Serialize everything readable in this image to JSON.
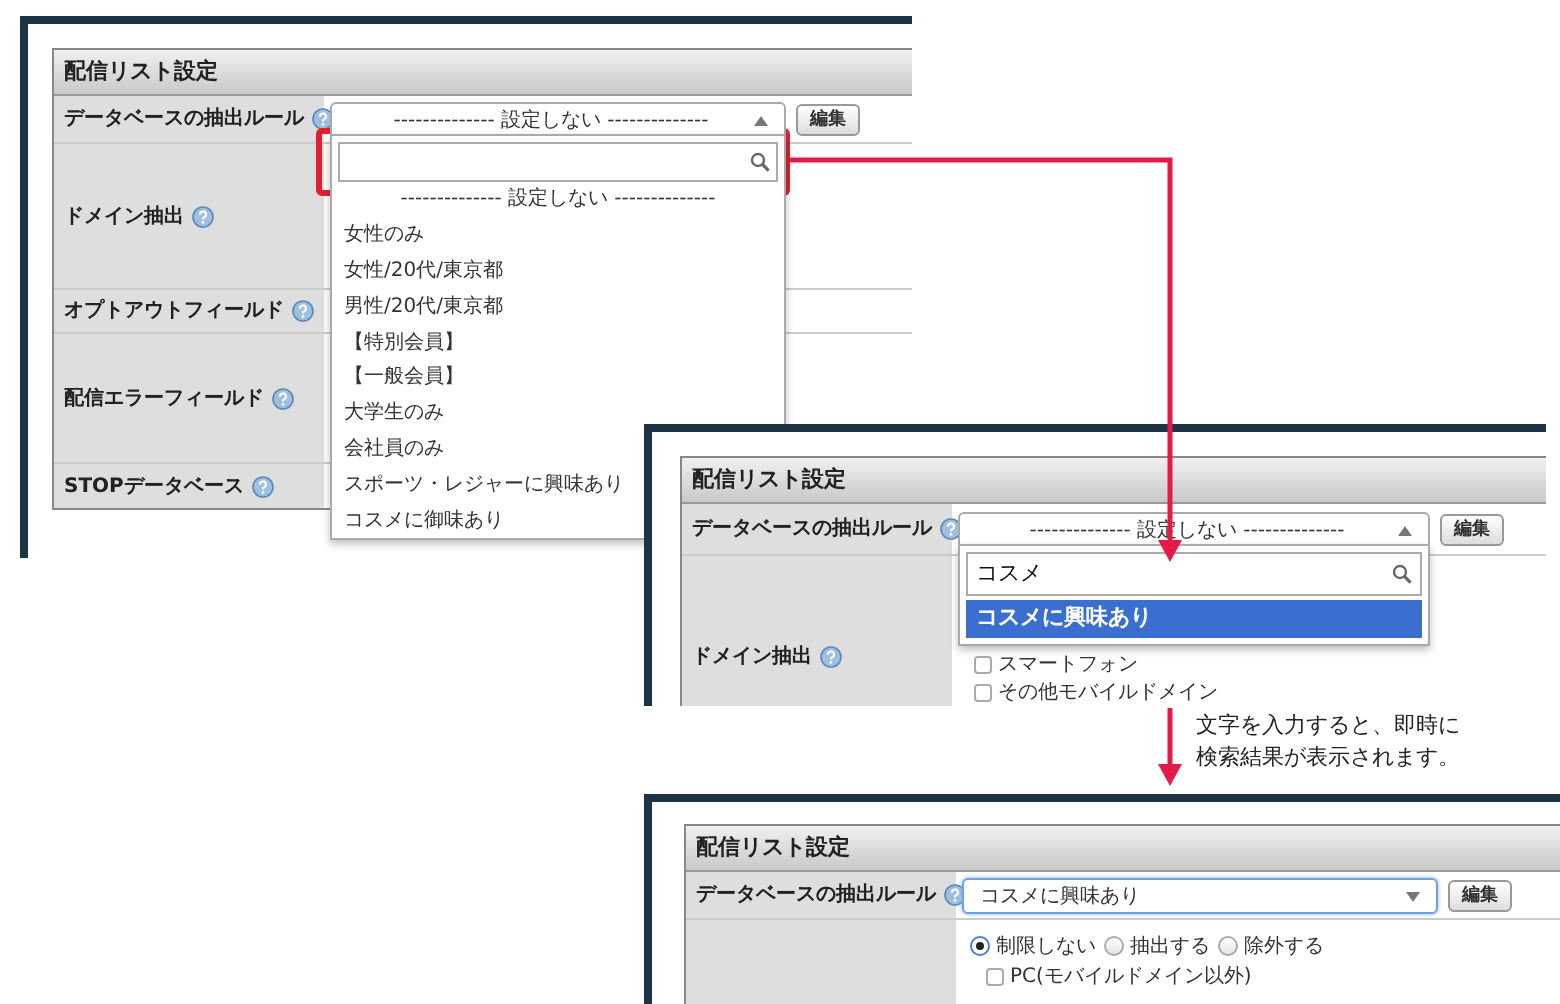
{
  "step1": {
    "title": "配信リスト設定",
    "rows": [
      {
        "label": "データベースの抽出ルール"
      },
      {
        "label": "ドメイン抽出"
      },
      {
        "label": "オプトアウトフィールド"
      },
      {
        "label": "配信エラーフィールド"
      },
      {
        "label": "STOPデータベース"
      }
    ],
    "select": {
      "value": "-------------- 設定しない --------------",
      "open": true
    },
    "edit_button": "編集",
    "dropdown": {
      "items": [
        {
          "label": "-------------- 設定しない --------------",
          "selected": false
        },
        {
          "label": "女性のみ",
          "selected": false
        },
        {
          "label": "女性/20代/東京都",
          "selected": false
        },
        {
          "label": "男性/20代/東京都",
          "selected": false
        },
        {
          "label": "【特別会員】",
          "selected": false
        },
        {
          "label": "【一般会員】",
          "selected": false
        },
        {
          "label": "大学生のみ",
          "selected": false
        },
        {
          "label": "会社員のみ",
          "selected": false
        },
        {
          "label": "スポーツ・レジャーに興味あり",
          "selected": false
        },
        {
          "label": "コスメに御味あり",
          "selected": false
        }
      ]
    }
  },
  "step2": {
    "title": "配信リスト設定",
    "rows": [
      {
        "label": "データベースの抽出ルール"
      },
      {
        "label": "ドメイン抽出"
      }
    ],
    "select": {
      "value": "-------------- 設定しない --------------",
      "open": true
    },
    "edit_button": "編集",
    "dropdown": {
      "search_value": "コスメ",
      "items": [
        {
          "label": "コスメに興味あり",
          "selected": true
        }
      ]
    },
    "domain_options": [
      {
        "label": "スマートフォン",
        "checked": false
      },
      {
        "label": "その他モバイルドメイン",
        "checked": false
      }
    ]
  },
  "caption": "文字を入力すると、即時に検索結果が表示されます。",
  "step3": {
    "title": "配信リスト設定",
    "rows": [
      {
        "label": "データベースの抽出ルール"
      }
    ],
    "select": {
      "value": "コスメに興味あり",
      "open": false
    },
    "edit_button": "編集",
    "domain_mode": [
      {
        "label": "制限しない",
        "selected": true
      },
      {
        "label": "抽出する",
        "selected": false
      },
      {
        "label": "除外する",
        "selected": false
      }
    ],
    "domain_options": [
      {
        "label": "PC(モバイルドメイン以外)",
        "checked": false
      }
    ]
  }
}
